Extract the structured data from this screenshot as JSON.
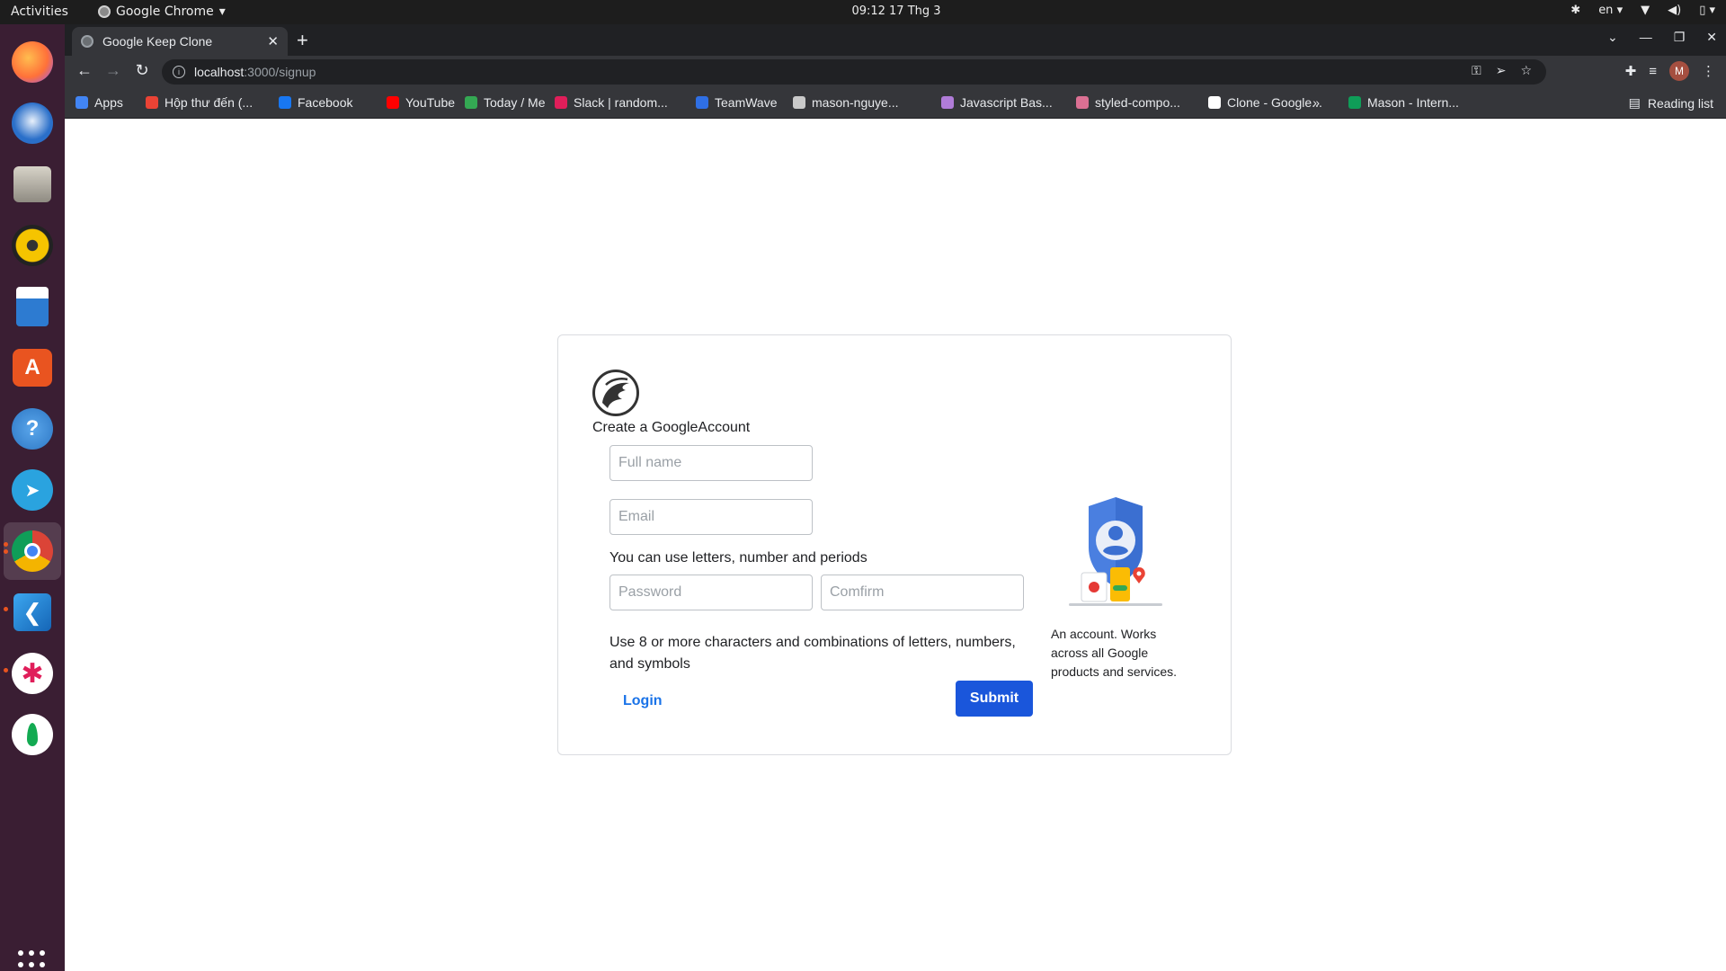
{
  "topbar": {
    "activities": "Activities",
    "app_name": "Google Chrome",
    "clock": "09:12  17 Thg 3",
    "language": "en"
  },
  "dock": {
    "apps": [
      {
        "name": "Firefox",
        "icon": "firefox-icon",
        "color": "#ff7139"
      },
      {
        "name": "Thunderbird",
        "icon": "thunderbird-icon",
        "color": "#2a6fc9"
      },
      {
        "name": "Files",
        "icon": "files-icon",
        "color": "#9b9b9b"
      },
      {
        "name": "Rhythmbox",
        "icon": "rhythmbox-icon",
        "color": "#f5c400"
      },
      {
        "name": "LibreOffice Writer",
        "icon": "writer-icon",
        "color": "#2d7bd1"
      },
      {
        "name": "Ubuntu Software",
        "icon": "software-icon",
        "color": "#e95420"
      },
      {
        "name": "Help",
        "icon": "help-icon",
        "color": "#3d8fd9"
      },
      {
        "name": "Telegram",
        "icon": "telegram-icon",
        "color": "#2aa3df"
      },
      {
        "name": "Google Chrome",
        "icon": "chrome-icon",
        "color": "#db4437"
      },
      {
        "name": "Visual Studio Code",
        "icon": "vscode-icon",
        "color": "#1f8ad2"
      },
      {
        "name": "Slack",
        "icon": "slack-icon",
        "color": "#ffffff"
      },
      {
        "name": "MongoDB Compass",
        "icon": "mongodb-icon",
        "color": "#ffffff"
      }
    ]
  },
  "browser": {
    "tab_title": "Google Keep Clone",
    "url_host": "localhost",
    "url_path": ":3000/signup",
    "bookmarks": [
      {
        "label": "Apps",
        "color": "#4285f4"
      },
      {
        "label": "Hộp thư đến (...",
        "color": "#ea4335"
      },
      {
        "label": "Facebook",
        "color": "#1877f2"
      },
      {
        "label": "YouTube",
        "color": "#ff0000"
      },
      {
        "label": "Today / Me",
        "color": "#34a853"
      },
      {
        "label": "Slack | random...",
        "color": "#e01e5a"
      },
      {
        "label": "TeamWave",
        "color": "#2f6fe4"
      },
      {
        "label": "mason-nguye...",
        "color": "#c9c9c9"
      },
      {
        "label": "Javascript Bas...",
        "color": "#b07cd8"
      },
      {
        "label": "styled-compo...",
        "color": "#db7093"
      },
      {
        "label": "Clone - Google...",
        "color": "#ffffff"
      },
      {
        "label": "Mason - Intern...",
        "color": "#0f9d58"
      }
    ],
    "more_bookmarks": "»",
    "reading_list": "Reading list",
    "avatar_letter": "M"
  },
  "signup": {
    "title": "Create a GoogleAccount",
    "fullname_placeholder": "Full name",
    "email_placeholder": "Email",
    "email_hint": "You can use letters, number and periods",
    "password_placeholder": "Password",
    "confirm_placeholder": "Comfirm",
    "password_hint": "Use 8 or more characters and combinations of letters, numbers, and symbols",
    "login_label": "Login",
    "submit_label": "Submit",
    "side_caption": "An account. Works across all Google products and services."
  },
  "colors": {
    "accent": "#1a56db",
    "link": "#1a73e8"
  }
}
